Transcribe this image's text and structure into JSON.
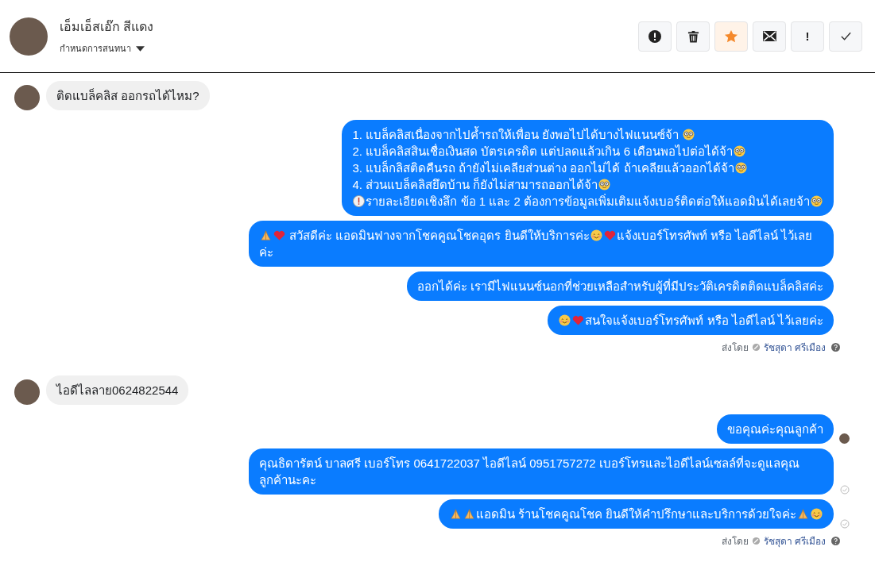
{
  "header": {
    "name": "เอ็มเอ็สเอ๊ก สีแดง",
    "menu_label": "กำหนดการสนทนา",
    "buttons": [
      {
        "kind": "alert",
        "on": false
      },
      {
        "kind": "trash",
        "on": false
      },
      {
        "kind": "star",
        "on": true
      },
      {
        "kind": "mail",
        "on": false
      },
      {
        "kind": "text",
        "label": "!",
        "on": false
      },
      {
        "kind": "check",
        "on": false
      }
    ]
  },
  "messages": [
    {
      "kind": "incoming",
      "parts": [
        {
          "kind": "text",
          "text": "ติดแบล็คลิส ออกรถได้ไหม?"
        }
      ]
    },
    {
      "kind": "outgoing",
      "parts": [
        {
          "kind": "text",
          "text": "1. แบล็คลิสเนื่องจากไปค้ำรถให้เพื่อน ยังพอไปได้บางไฟแนนซ์จ้า "
        },
        {
          "kind": "nerd"
        },
        {
          "kind": "break"
        },
        {
          "kind": "text",
          "text": "2. แบล็คลิสสินเชื่อเงินสด บัตรเครดิต แต่ปลดแล้วเกิน 6 เดือนพอไปต่อได้จ้า"
        },
        {
          "kind": "nerd"
        },
        {
          "kind": "break"
        },
        {
          "kind": "text",
          "text": "3. แบล็กลิสติดคืนรถ ถ้ายังไม่เคลียส่วนต่าง ออกไม่ได้ ถ้าเคลียแล้วออกได้จ้า"
        },
        {
          "kind": "nerd"
        },
        {
          "kind": "break"
        },
        {
          "kind": "text",
          "text": "4. ส่วนแบล็คลิสยึดบ้าน ก็ยังไม่สามารถออกได้จ้า"
        },
        {
          "kind": "nerd"
        },
        {
          "kind": "break"
        },
        {
          "kind": "info"
        },
        {
          "kind": "text",
          "text": "รายละเอียดเชิงลึก ข้อ 1 และ 2 ต้องการข้อมูลเพิ่มเติมแจ้งเบอร์ติดต่อให้แอดมินได้เลยจ้า"
        },
        {
          "kind": "nerd"
        }
      ]
    },
    {
      "kind": "outgoing",
      "parts": [
        {
          "kind": "pray"
        },
        {
          "kind": "heart"
        },
        {
          "kind": "text",
          "text": " สวัสดีค่ะ แอดมินฟางจากโชคคูณโชคอุดร ยินดีให้บริการค่ะ"
        },
        {
          "kind": "love"
        },
        {
          "kind": "heart"
        },
        {
          "kind": "text",
          "text": "แจ้งเบอร์โทรศัพท์ หรือ ไอดีไลน์  ไว้เลยค่ะ"
        }
      ]
    },
    {
      "kind": "outgoing",
      "parts": [
        {
          "kind": "text",
          "text": "ออกได้ค่ะ เรามีไฟแนนซ์นอกที่ช่วยเหลือสำหรับผู้ที่มีประวัติเครดิตติดแบล็คลิสค่ะ"
        }
      ]
    },
    {
      "kind": "outgoing",
      "parts": [
        {
          "kind": "love"
        },
        {
          "kind": "heart"
        },
        {
          "kind": "text",
          "text": "สนใจแจ้งเบอร์โทรศัพท์ หรือ ไอดีไลน์  ไว้เลยค่ะ"
        }
      ]
    },
    {
      "kind": "sent_by",
      "label": "ส่งโดย",
      "name": "รัชสุดา ศรีเมือง"
    },
    {
      "kind": "incoming",
      "parts": [
        {
          "kind": "text",
          "text": "ไอดีไลลาย0624822544"
        }
      ]
    },
    {
      "kind": "outgoing",
      "seen": true,
      "parts": [
        {
          "kind": "text",
          "text": "ขอคุณค่ะคุณลูกค้า"
        }
      ]
    },
    {
      "kind": "outgoing",
      "delivered": true,
      "parts": [
        {
          "kind": "text",
          "text": "คุณธิดารัตน์ บาลศรี เบอร์โทร 0641722037  ไอดีไลน์ 0951757272  เบอร์โทรและไอดีไลน์เซลล์ที่จะดูแลคุณลูกค้านะคะ"
        }
      ]
    },
    {
      "kind": "outgoing",
      "delivered": true,
      "parts": [
        {
          "kind": "pray"
        },
        {
          "kind": "pray"
        },
        {
          "kind": "text",
          "text": "แอดมิน ร้านโชคคูณโชค ยินดีให้คำปรึกษาและบริการด้วยใจค่ะ"
        },
        {
          "kind": "pray"
        },
        {
          "kind": "love"
        }
      ]
    },
    {
      "kind": "sent_by",
      "label": "ส่งโดย",
      "name": "รัชสุดา ศรีเมือง"
    }
  ]
}
